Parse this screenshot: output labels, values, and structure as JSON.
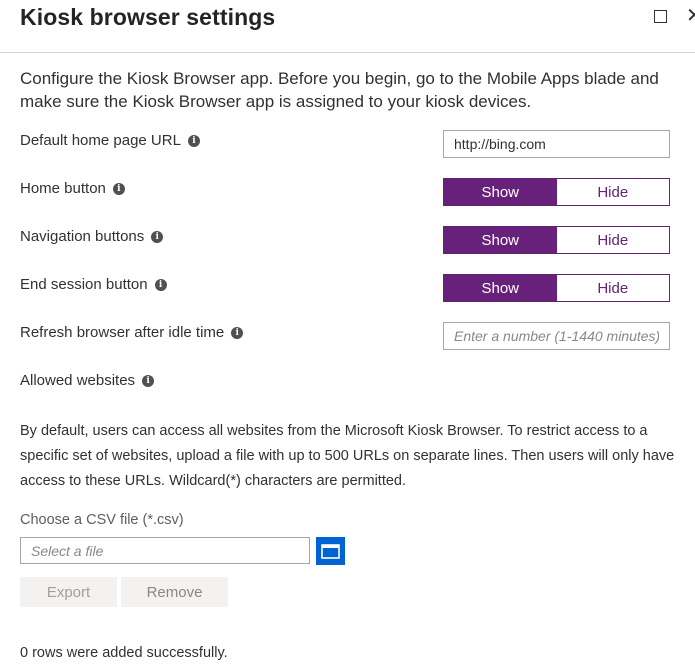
{
  "header": {
    "title": "Kiosk browser settings"
  },
  "intro": "Configure the Kiosk Browser app. Before you begin, go to the Mobile Apps blade and make sure the Kiosk Browser app is assigned to your kiosk devices.",
  "settings": {
    "home_page": {
      "label": "Default home page URL",
      "value": "http://bing.com"
    },
    "home_button": {
      "label": "Home button",
      "selected": "Show",
      "options": [
        "Show",
        "Hide"
      ]
    },
    "navigation_buttons": {
      "label": "Navigation buttons",
      "selected": "Show",
      "options": [
        "Show",
        "Hide"
      ]
    },
    "end_session_button": {
      "label": "End session button",
      "selected": "Show",
      "options": [
        "Show",
        "Hide"
      ]
    },
    "refresh_idle": {
      "label": "Refresh browser after idle time",
      "placeholder": "Enter a number (1-1440 minutes)"
    },
    "allowed_websites": {
      "label": "Allowed websites"
    }
  },
  "description": "By default, users can access all websites from the Microsoft Kiosk Browser. To restrict access to a specific set of websites, upload a file with up to 500 URLs on separate lines. Then users will only have access to these URLs. Wildcard(*) characters are permitted.",
  "csv": {
    "label": "Choose a CSV file (*.csv)",
    "placeholder": "Select a file"
  },
  "buttons": {
    "export": "Export",
    "remove": "Remove"
  },
  "status": "0 rows were added successfully.",
  "colors": {
    "accent": "#68217a",
    "browse": "#0063d3"
  },
  "icons": [
    "maximize-icon",
    "close-icon",
    "info-icon",
    "folder-icon"
  ]
}
